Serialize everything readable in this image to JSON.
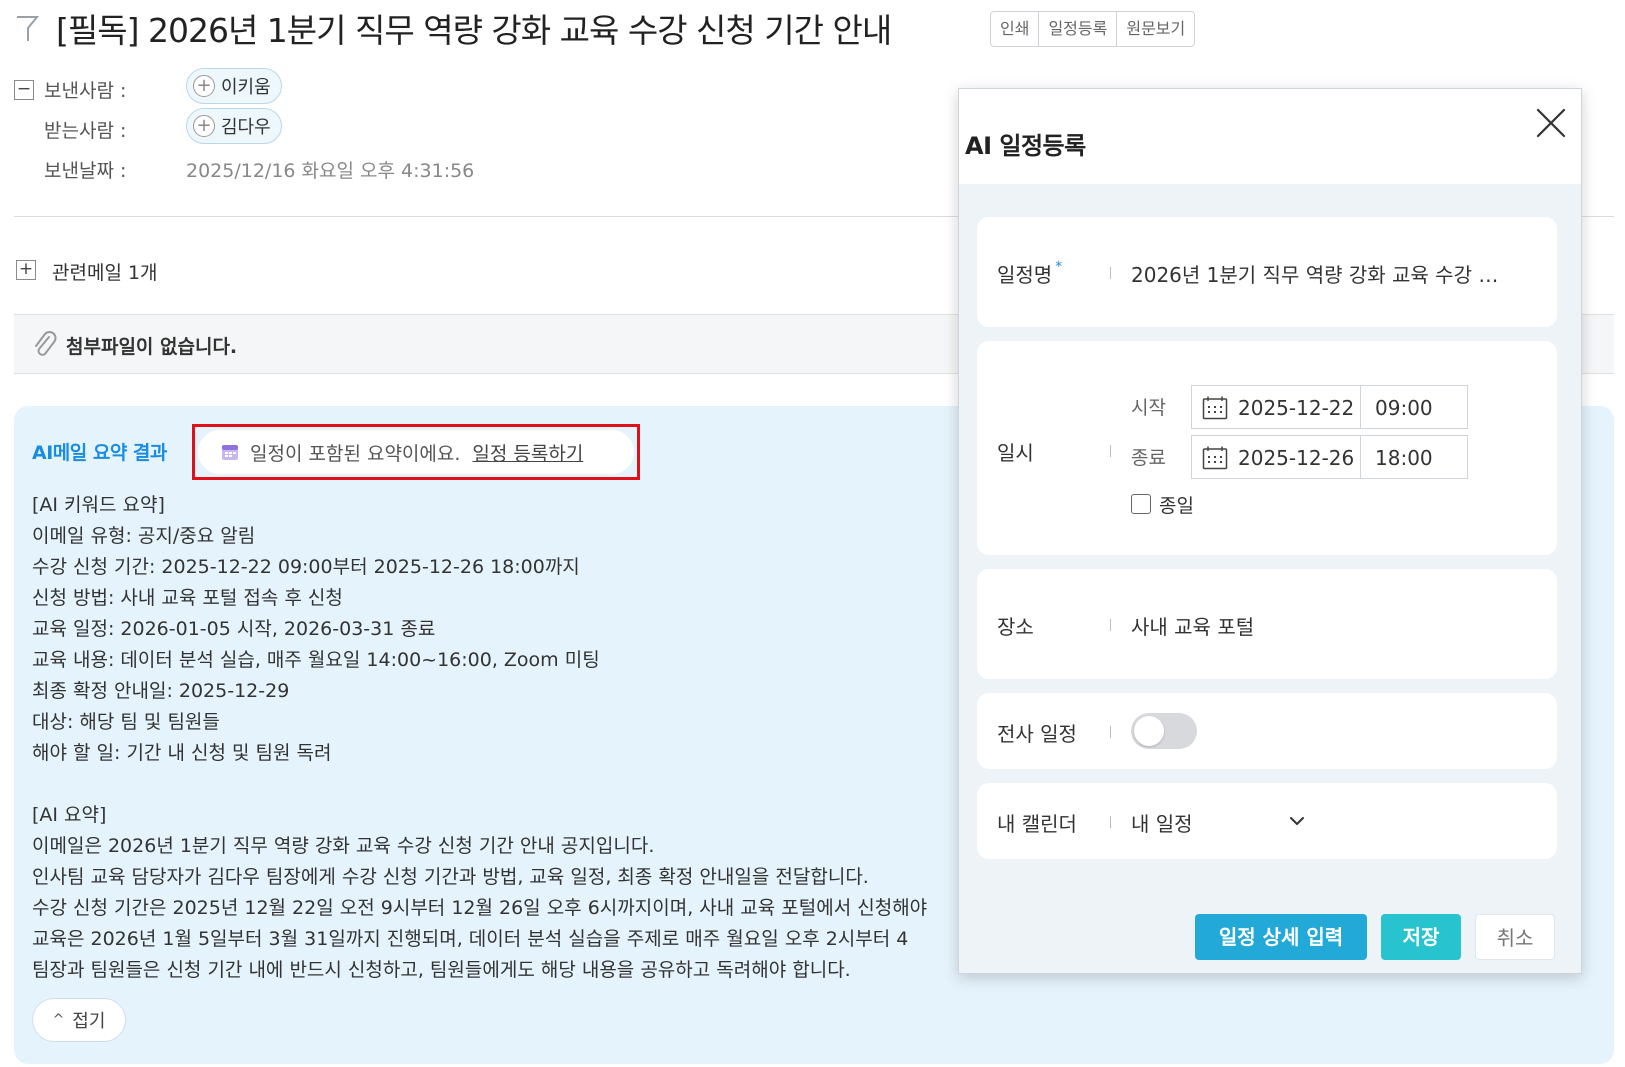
{
  "mail": {
    "title": "[필독] 2026년 1분기 직무 역량 강화 교육 수강 신청 기간 안내",
    "actions": [
      "인쇄",
      "일정등록",
      "원문보기"
    ],
    "sender_label": "보낸사람 :",
    "sender": "이키움",
    "recipient_label": "받는사람 :",
    "recipient": "김다우",
    "date_label": "보낸날짜 :",
    "date": "2025/12/16 화요일 오후 4:31:56",
    "related": "관련메일 1개",
    "no_attachment": "첨부파일이 없습니다."
  },
  "ai_summary": {
    "title": "AI메일 요약 결과",
    "schedule_notice": "일정이 포함된 요약이에요.",
    "schedule_link": "일정 등록하기",
    "keyword_lines": [
      "[AI 키워드 요약]",
      "이메일 유형: 공지/중요 알림",
      "수강 신청 기간: 2025-12-22 09:00부터 2025-12-26 18:00까지",
      "신청 방법: 사내 교육 포털 접속 후 신청",
      "교육 일정: 2026-01-05 시작, 2026-03-31 종료",
      "교육 내용: 데이터 분석 실습, 매주 월요일 14:00~16:00, Zoom 미팅",
      "최종 확정 안내일: 2025-12-29",
      "대상: 해당 팀 및 팀원들",
      "해야 할 일: 기간 내 신청 및 팀원 독려"
    ],
    "summary_lines": [
      "[AI 요약]",
      "이메일은 2026년 1분기 직무 역량 강화 교육 수강 신청 기간 안내 공지입니다.",
      "인사팀 교육 담당자가 김다우 팀장에게 수강 신청 기간과 방법, 교육 일정, 최종 확정 안내일을 전달합니다.",
      "수강 신청 기간은 2025년 12월 22일 오전 9시부터 12월 26일 오후 6시까지이며, 사내 교육 포털에서 신청해야",
      "교육은 2026년 1월 5일부터 3월 31일까지 진행되며, 데이터 분석 실습을 주제로 매주 월요일 오후 2시부터 4",
      "팀장과 팀원들은 신청 기간 내에 반드시 신청하고, 팀원들에게도 해당 내용을 공유하고 독려해야 합니다."
    ],
    "fold_label": "접기"
  },
  "modal": {
    "title": "AI 일정등록",
    "name_label": "일정명",
    "name_required": "*",
    "name_value": "2026년 1분기 직무 역량 강화 교육 수강 …",
    "datetime_label": "일시",
    "start_label": "시작",
    "start_date": "2025-12-22",
    "start_time": "09:00",
    "end_label": "종료",
    "end_date": "2025-12-26",
    "end_time": "18:00",
    "allday_label": "종일",
    "allday_checked": false,
    "place_label": "장소",
    "place_value": "사내 교육 포털",
    "company_label": "전사 일정",
    "company_on": false,
    "calendar_label": "내 캘린더",
    "calendar_value": "내 일정",
    "btn_detail": "일정 상세 입력",
    "btn_save": "저장",
    "btn_cancel": "취소"
  },
  "colors": {
    "accent_blue": "#1a8de0",
    "highlight_red": "#e0101a",
    "button_detail": "#22a9d8",
    "button_save": "#27c4cf",
    "panel_bg": "#e5f3fc"
  }
}
